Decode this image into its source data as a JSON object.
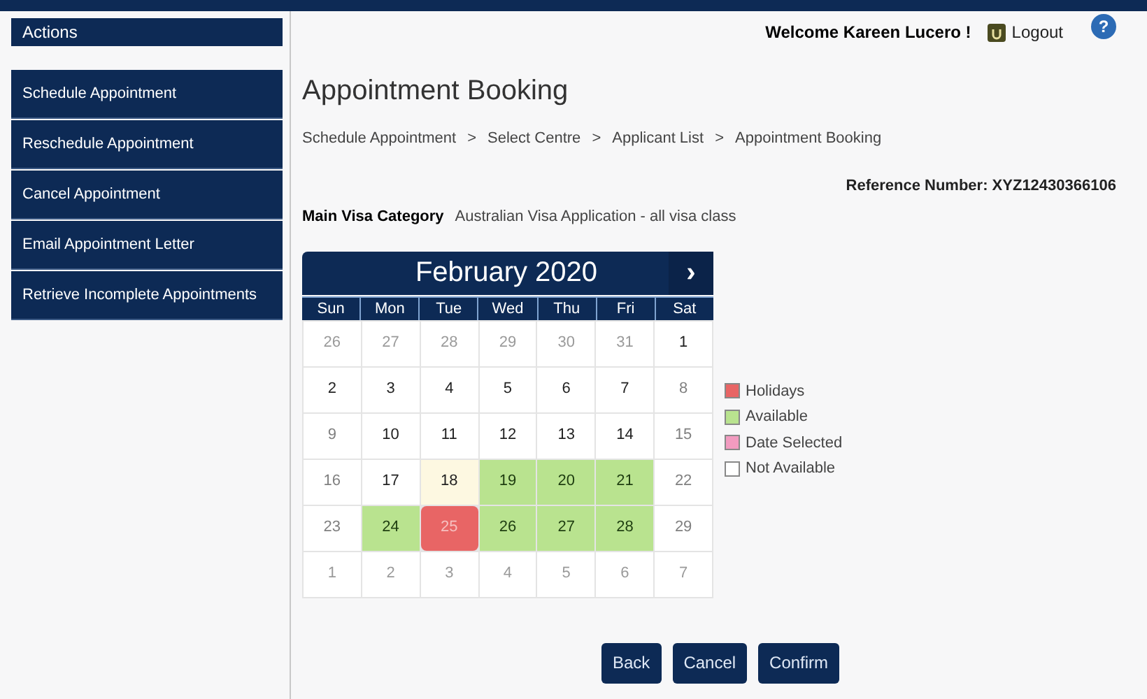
{
  "sidebar": {
    "title": "Actions",
    "items": [
      {
        "label": "Schedule Appointment"
      },
      {
        "label": "Reschedule Appointment"
      },
      {
        "label": "Cancel Appointment"
      },
      {
        "label": "Email Appointment Letter"
      },
      {
        "label": "Retrieve Incomplete Appointments"
      }
    ]
  },
  "header": {
    "welcome": "Welcome Kareen Lucero !",
    "logout": "Logout",
    "help": "?"
  },
  "page_title": "Appointment Booking",
  "breadcrumb": [
    "Schedule Appointment",
    "Select Centre",
    "Applicant List",
    "Appointment Booking"
  ],
  "breadcrumb_separator": ">",
  "reference": "Reference Number: XYZ12430366106",
  "visa_category": {
    "label": "Main Visa Category",
    "value": "Australian Visa Application - all visa class"
  },
  "calendar": {
    "month": "February 2020",
    "next": "›",
    "weekdays": [
      "Sun",
      "Mon",
      "Tue",
      "Wed",
      "Thu",
      "Fri",
      "Sat"
    ],
    "weeks": [
      [
        {
          "day": "26",
          "kind": "outside"
        },
        {
          "day": "27",
          "kind": "outside"
        },
        {
          "day": "28",
          "kind": "outside"
        },
        {
          "day": "29",
          "kind": "outside"
        },
        {
          "day": "30",
          "kind": "outside"
        },
        {
          "day": "31",
          "kind": "outside"
        },
        {
          "day": "1",
          "kind": "open"
        }
      ],
      [
        {
          "day": "2",
          "kind": "open"
        },
        {
          "day": "3",
          "kind": "open"
        },
        {
          "day": "4",
          "kind": "open"
        },
        {
          "day": "5",
          "kind": "open"
        },
        {
          "day": "6",
          "kind": "open"
        },
        {
          "day": "7",
          "kind": "open"
        },
        {
          "day": "8",
          "kind": "closed"
        }
      ],
      [
        {
          "day": "9",
          "kind": "closed"
        },
        {
          "day": "10",
          "kind": "open"
        },
        {
          "day": "11",
          "kind": "open"
        },
        {
          "day": "12",
          "kind": "open"
        },
        {
          "day": "13",
          "kind": "open"
        },
        {
          "day": "14",
          "kind": "open"
        },
        {
          "day": "15",
          "kind": "closed"
        }
      ],
      [
        {
          "day": "16",
          "kind": "closed"
        },
        {
          "day": "17",
          "kind": "open"
        },
        {
          "day": "18",
          "kind": "today"
        },
        {
          "day": "19",
          "kind": "available"
        },
        {
          "day": "20",
          "kind": "available"
        },
        {
          "day": "21",
          "kind": "available"
        },
        {
          "day": "22",
          "kind": "closed"
        }
      ],
      [
        {
          "day": "23",
          "kind": "closed"
        },
        {
          "day": "24",
          "kind": "available"
        },
        {
          "day": "25",
          "kind": "holiday"
        },
        {
          "day": "26",
          "kind": "available"
        },
        {
          "day": "27",
          "kind": "available"
        },
        {
          "day": "28",
          "kind": "available"
        },
        {
          "day": "29",
          "kind": "closed"
        }
      ],
      [
        {
          "day": "1",
          "kind": "outside"
        },
        {
          "day": "2",
          "kind": "outside"
        },
        {
          "day": "3",
          "kind": "outside"
        },
        {
          "day": "4",
          "kind": "outside"
        },
        {
          "day": "5",
          "kind": "outside"
        },
        {
          "day": "6",
          "kind": "outside"
        },
        {
          "day": "7",
          "kind": "outside"
        }
      ]
    ]
  },
  "legend": [
    {
      "label": "Holidays",
      "color": "#e86565"
    },
    {
      "label": "Available",
      "color": "#b9e38f"
    },
    {
      "label": "Date Selected",
      "color": "#f29bc0"
    },
    {
      "label": "Not Available",
      "color": "#ffffff"
    }
  ],
  "buttons": [
    "Back",
    "Cancel",
    "Confirm"
  ]
}
